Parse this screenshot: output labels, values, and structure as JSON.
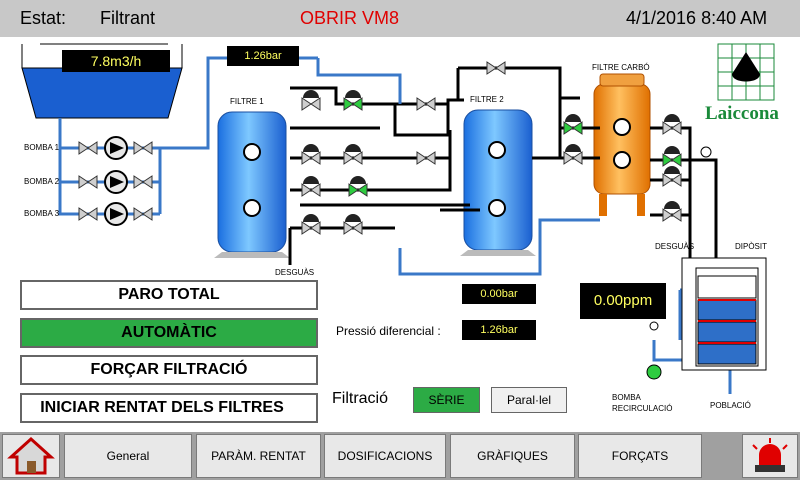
{
  "header": {
    "status_label": "Estat:",
    "status_value": "Filtrant",
    "alarm": "OBRIR VM8",
    "datetime": "4/1/2016 8:40 AM"
  },
  "readouts": {
    "tank_flow": "7.8m3/h",
    "inlet_pressure": "1.26bar",
    "pressure_a": "0.00bar",
    "diff_pressure": "1.26bar",
    "ppm": "0.00ppm"
  },
  "labels": {
    "pump1": "BOMBA 1",
    "pump2": "BOMBA 2",
    "pump3": "BOMBA 3",
    "filter1": "FILTRE 1",
    "filter2": "FILTRE 2",
    "carbon_filter": "FILTRE CARBÓ",
    "drain": "DESGUÀS",
    "drain2": "DESGUÀS",
    "deposit": "DIPÒSIT",
    "recirc_pump_line1": "BOMBA",
    "recirc_pump_line2": "RECIRCULACIÓ",
    "population": "POBLACIÓ",
    "diff_pressure_label": "Pressió diferencial :",
    "filtration": "Filtració"
  },
  "brand": "Laiccona",
  "commands": {
    "stop": "PARO TOTAL",
    "auto": "AUTOMÀTIC",
    "force": "FORÇAR FILTRACIÓ",
    "wash": "INICIAR RENTAT DELS FILTRES"
  },
  "mode": {
    "series": "SÈRIE",
    "parallel": "Paral·lel"
  },
  "nav": {
    "general": "General",
    "wash_params": "PARÀM. RENTAT",
    "dosing": "DOSIFICACIONS",
    "charts": "GRÀFIQUES",
    "forced": "FORÇATS"
  },
  "colors": {
    "active_green": "#2cab45",
    "tank_blue": "#1a5fd0",
    "carbon_orange": "#f08a10",
    "alarm_red": "#e00000"
  },
  "icons": [
    "home-icon",
    "alarm-beacon-icon"
  ]
}
